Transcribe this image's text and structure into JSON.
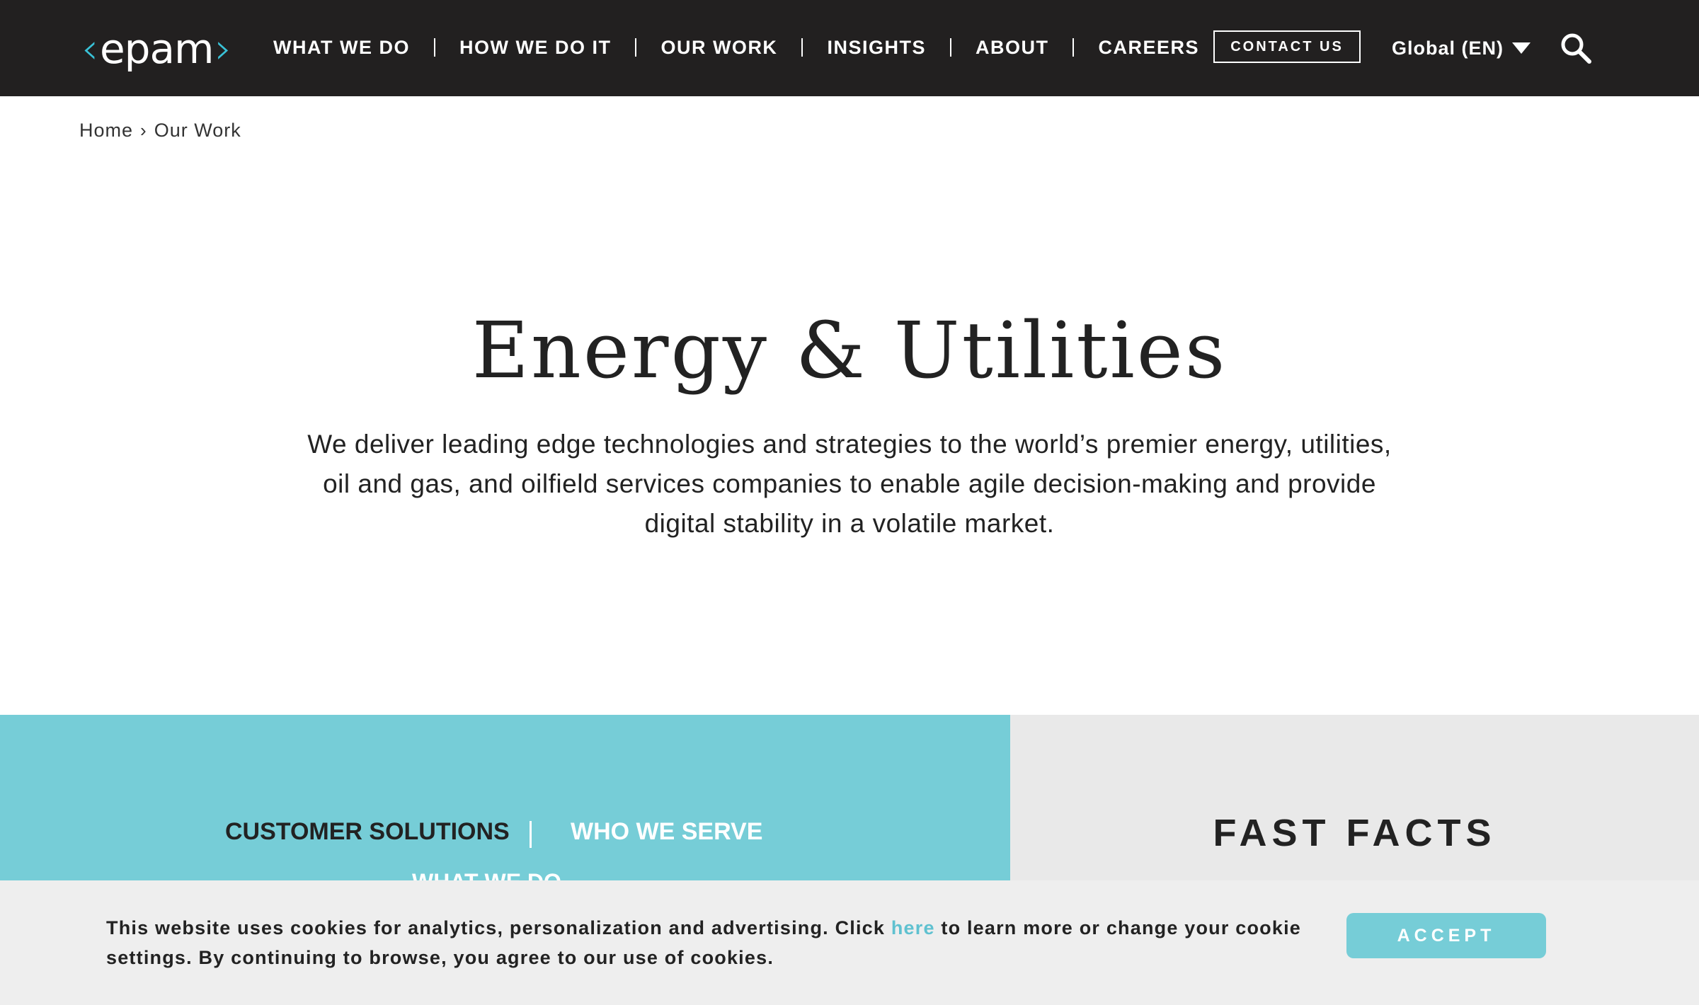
{
  "header": {
    "logo_text": "epam",
    "nav": [
      {
        "label": "WHAT WE DO"
      },
      {
        "label": "HOW WE DO IT"
      },
      {
        "label": "OUR WORK"
      },
      {
        "label": "INSIGHTS"
      },
      {
        "label": "ABOUT"
      },
      {
        "label": "CAREERS"
      }
    ],
    "contact_label": "CONTACT US",
    "language_label": "Global (EN)",
    "search_icon": "search-icon"
  },
  "breadcrumb": {
    "home": "Home",
    "separator": "›",
    "current": "Our Work"
  },
  "hero": {
    "title": "Energy & Utilities",
    "description": "We deliver leading edge technologies and strategies to the world’s premier energy, utilities, oil and gas, and oilfield services companies to enable agile decision-making and provide digital stability in a volatile market."
  },
  "tabs": {
    "active": "CUSTOMER SOLUTIONS",
    "inactive": "WHO WE SERVE",
    "peek": "WHAT WE DO"
  },
  "fast_facts": {
    "title": "FAST FACTS"
  },
  "cookie": {
    "text_before": "This website uses cookies for analytics, personalization and advertising. Click ",
    "link": "here",
    "text_after": " to learn more or change your cookie settings. By continuing to browse, you agree to our use of cookies.",
    "accept_label": "ACCEPT"
  },
  "colors": {
    "header_bg": "#222020",
    "accent": "#39c2d7",
    "panel_teal": "#76cdd7",
    "panel_grey": "#e9e9e9",
    "cookie_bg": "#eeeeee"
  }
}
